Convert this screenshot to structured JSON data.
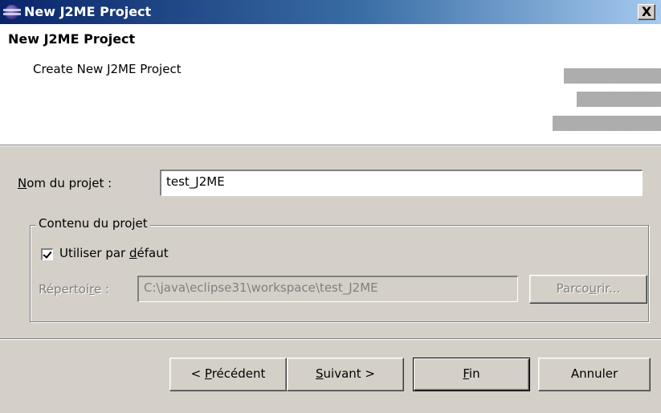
{
  "window": {
    "title": "New J2ME Project",
    "close_label": "X"
  },
  "banner": {
    "title": "New J2ME Project",
    "description": "Create New J2ME Project"
  },
  "form": {
    "project_name": {
      "label_mnemonic": "N",
      "label_rest": "om du projet :",
      "value": "test_J2ME"
    },
    "contents_group": {
      "legend": "Contenu du projet",
      "use_default": {
        "label_before": "Utiliser par ",
        "label_mnemonic": "d",
        "label_after": "éfaut",
        "checked": true
      },
      "directory": {
        "label_before": "Répertoi",
        "label_mnemonic": "r",
        "label_after": "e :",
        "value": "C:\\java\\eclipse31\\workspace\\test_J2ME"
      },
      "browse": {
        "label_before": "Parco",
        "label_mnemonic": "u",
        "label_after": "rir..."
      }
    }
  },
  "buttons": {
    "back": {
      "prefix": "< ",
      "mnemonic": "P",
      "rest": "récédent"
    },
    "next": {
      "mnemonic": "S",
      "rest": "uivant >"
    },
    "finish": {
      "mnemonic": "F",
      "rest": "in"
    },
    "cancel": {
      "label": "Annuler"
    }
  }
}
